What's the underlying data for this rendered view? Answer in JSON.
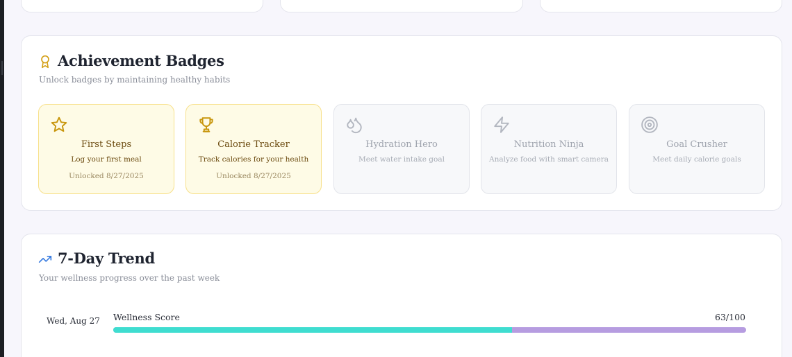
{
  "achievements": {
    "title": "Achievement Badges",
    "subtitle": "Unlock badges by maintaining healthy habits",
    "icon": "award-icon",
    "badges": [
      {
        "name": "First Steps",
        "description": "Log your first meal",
        "status": "Unlocked 8/27/2025",
        "unlocked": true,
        "icon": "star-icon"
      },
      {
        "name": "Calorie Tracker",
        "description": "Track calories for your health",
        "status": "Unlocked 8/27/2025",
        "unlocked": true,
        "icon": "trophy-icon"
      },
      {
        "name": "Hydration Hero",
        "description": "Meet water intake goal",
        "status": "",
        "unlocked": false,
        "icon": "droplets-icon"
      },
      {
        "name": "Nutrition Ninja",
        "description": "Analyze food with smart camera",
        "status": "",
        "unlocked": false,
        "icon": "lightning-icon"
      },
      {
        "name": "Goal Crusher",
        "description": "Meet daily calorie goals",
        "status": "",
        "unlocked": false,
        "icon": "target-icon"
      }
    ]
  },
  "trend": {
    "title": "7-Day Trend",
    "subtitle": "Your wellness progress over the past week",
    "icon": "trending-up-icon",
    "rows": [
      {
        "date": "Wed, Aug 27",
        "metric": "Wellness Score",
        "score_text": "63/100",
        "progress": 0.63
      }
    ]
  },
  "colors": {
    "accent_gold": "#d4a017",
    "trend_blue": "#3b7de0",
    "bar_fill": "#3fddd0",
    "bar_track": "#b69ce0",
    "unlocked_bg": "#fefbe6",
    "locked_bg": "#f7f8fa"
  }
}
